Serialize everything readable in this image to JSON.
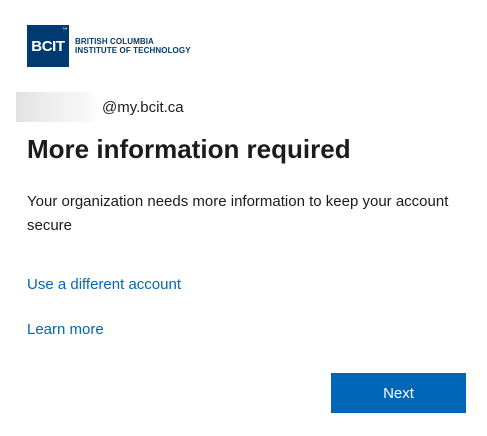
{
  "logo": {
    "mark_text": "BCIT",
    "trademark": "™",
    "line1": "BRITISH COLUMBIA",
    "line2": "INSTITUTE OF TECHNOLOGY"
  },
  "account": {
    "domain": "@my.bcit.ca"
  },
  "title": "More information required",
  "description": "Your organization needs more information to keep your account secure",
  "links": {
    "different_account": "Use a different account",
    "learn_more": "Learn more"
  },
  "buttons": {
    "next": "Next"
  },
  "colors": {
    "brand": "#003a70",
    "link": "#0067b8",
    "button_bg": "#0067b8",
    "text": "#1b1b1b"
  }
}
